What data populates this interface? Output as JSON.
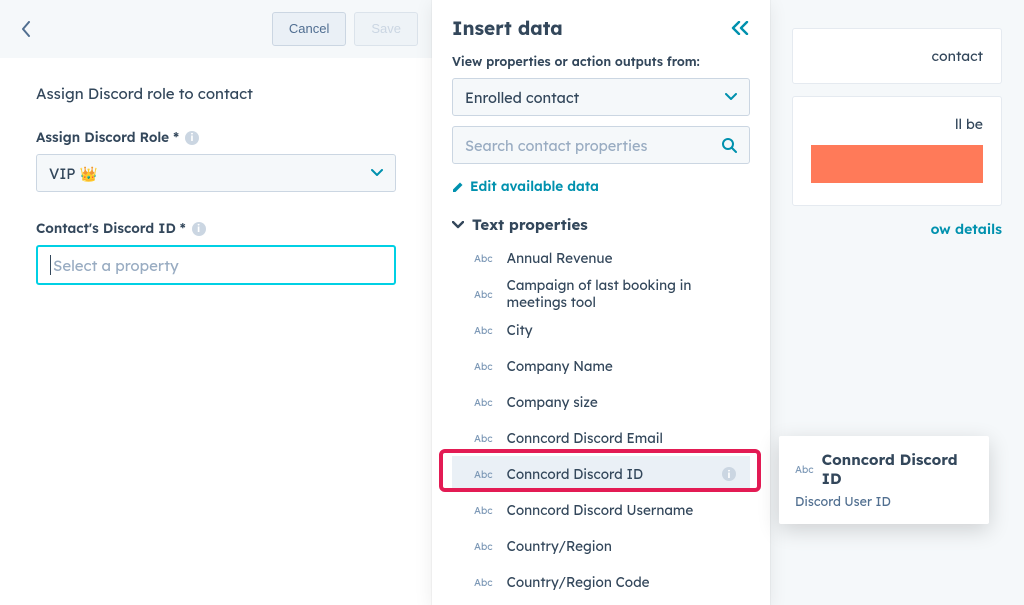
{
  "header": {
    "cancel": "Cancel",
    "save": "Save"
  },
  "config": {
    "title": "Assign Discord role to contact",
    "role_label": "Assign Discord Role *",
    "role_value": "VIP 👑",
    "discord_id_label": "Contact's Discord ID *",
    "discord_id_placeholder": "Select a property"
  },
  "flyout": {
    "title": "Insert data",
    "subtitle": "View properties or action outputs from:",
    "source_value": "Enrolled contact",
    "search_placeholder": "Search contact properties",
    "edit_link": "Edit available data",
    "group_header": "Text properties",
    "properties": [
      "Annual Revenue",
      "Campaign of last booking in meetings tool",
      "City",
      "Company Name",
      "Company size",
      "Conncord Discord Email",
      "Conncord Discord ID",
      "Conncord Discord Username",
      "Country/Region",
      "Country/Region Code"
    ],
    "highlight_index": 6
  },
  "right": {
    "card1_tail": "contact",
    "card2_tail": "ll be",
    "details_tail": "ow details"
  },
  "tooltip": {
    "title": "Conncord Discord ID",
    "desc": "Discord User ID"
  },
  "colors": {
    "teal": "#0091ae",
    "cyan": "#00d0e4",
    "orange": "#ff7a59",
    "ring": "#e31b54"
  }
}
